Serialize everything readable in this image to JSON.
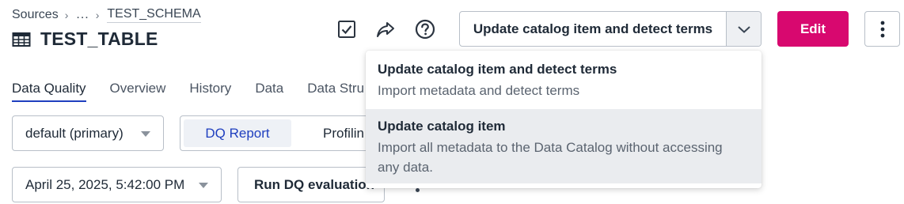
{
  "breadcrumb": {
    "items": [
      "Sources",
      "...",
      "TEST_SCHEMA"
    ]
  },
  "header": {
    "title": "TEST_TABLE",
    "icons": [
      "check-square-icon",
      "share-arrow-icon",
      "help-circle-icon"
    ]
  },
  "actions": {
    "split_label": "Update catalog item and detect terms",
    "edit_label": "Edit"
  },
  "tabs": [
    {
      "label": "Data Quality",
      "active": true
    },
    {
      "label": "Overview"
    },
    {
      "label": "History"
    },
    {
      "label": "Data"
    },
    {
      "label": "Data Stru"
    }
  ],
  "controls": {
    "env_select": "default (primary)",
    "segments": [
      "DQ Report",
      "Profilin"
    ],
    "date_select": "April 25, 2025, 5:42:00 PM",
    "run_label": "Run DQ evaluation"
  },
  "menu": {
    "items": [
      {
        "title": "Update catalog item and detect terms",
        "desc": "Import metadata and detect terms"
      },
      {
        "title": "Update catalog item",
        "desc_line1": "Import all metadata to the Data Catalog without accessing",
        "desc_line2": "any data."
      }
    ]
  },
  "colors": {
    "accent": "#d8086f",
    "link": "#1f3fbf",
    "menu_hover": "#eaecef"
  }
}
